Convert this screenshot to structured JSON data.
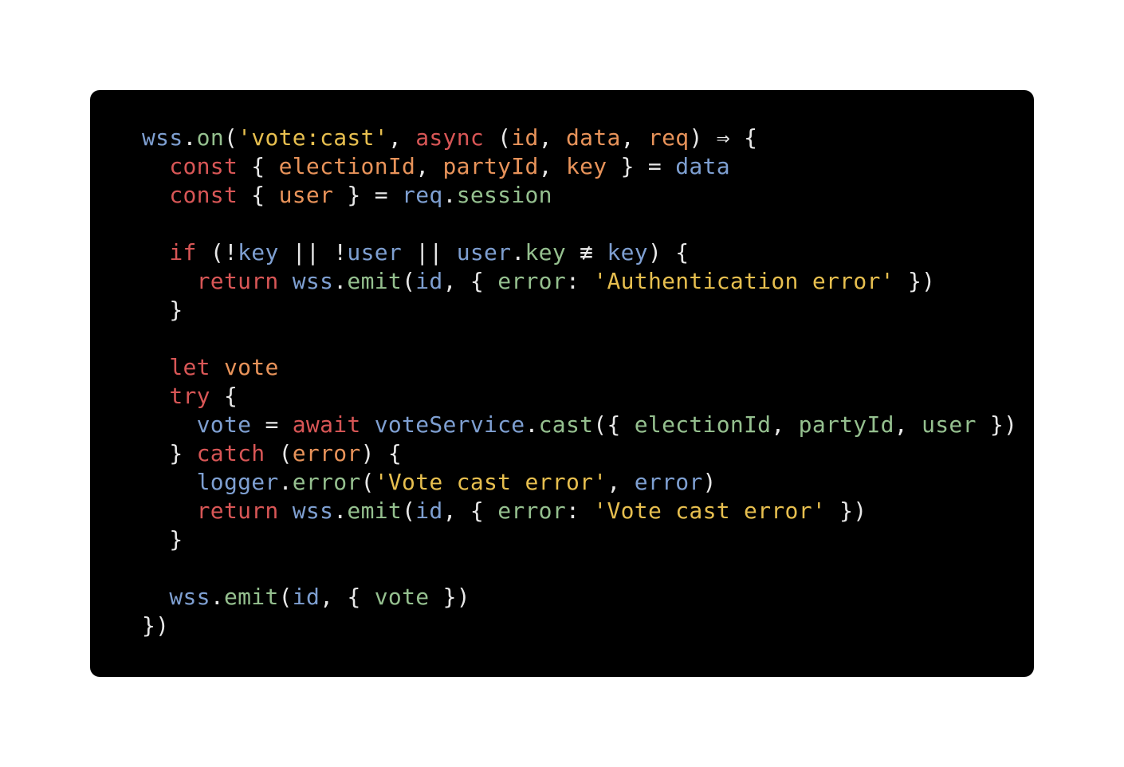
{
  "colors": {
    "page_background": "#ffffff",
    "editor_background": "#000000",
    "plain": "#e8e8e8",
    "identifier": "#7e9fd1",
    "property": "#95c08f",
    "string": "#e7bf4f",
    "keyword": "#d85656",
    "parameter": "#e8935a"
  },
  "code": {
    "language": "javascript",
    "lines": [
      [
        [
          "ident",
          "wss"
        ],
        [
          "plain",
          "."
        ],
        [
          "prop",
          "on"
        ],
        [
          "plain",
          "("
        ],
        [
          "string",
          "'vote:cast'"
        ],
        [
          "plain",
          ", "
        ],
        [
          "keyword",
          "async"
        ],
        [
          "plain",
          " ("
        ],
        [
          "param",
          "id"
        ],
        [
          "plain",
          ", "
        ],
        [
          "param",
          "data"
        ],
        [
          "plain",
          ", "
        ],
        [
          "param",
          "req"
        ],
        [
          "plain",
          ") ⇒ {"
        ]
      ],
      [
        [
          "plain",
          "  "
        ],
        [
          "keyword",
          "const"
        ],
        [
          "plain",
          " { "
        ],
        [
          "param",
          "electionId"
        ],
        [
          "plain",
          ", "
        ],
        [
          "param",
          "partyId"
        ],
        [
          "plain",
          ", "
        ],
        [
          "param",
          "key"
        ],
        [
          "plain",
          " } = "
        ],
        [
          "ident",
          "data"
        ]
      ],
      [
        [
          "plain",
          "  "
        ],
        [
          "keyword",
          "const"
        ],
        [
          "plain",
          " { "
        ],
        [
          "param",
          "user"
        ],
        [
          "plain",
          " } = "
        ],
        [
          "ident",
          "req"
        ],
        [
          "plain",
          "."
        ],
        [
          "prop",
          "session"
        ]
      ],
      [],
      [
        [
          "plain",
          "  "
        ],
        [
          "keyword",
          "if"
        ],
        [
          "plain",
          " (!"
        ],
        [
          "ident",
          "key"
        ],
        [
          "plain",
          " || !"
        ],
        [
          "ident",
          "user"
        ],
        [
          "plain",
          " || "
        ],
        [
          "ident",
          "user"
        ],
        [
          "plain",
          "."
        ],
        [
          "prop",
          "key"
        ],
        [
          "plain",
          " ≢ "
        ],
        [
          "ident",
          "key"
        ],
        [
          "plain",
          ") {"
        ]
      ],
      [
        [
          "plain",
          "    "
        ],
        [
          "keyword",
          "return"
        ],
        [
          "plain",
          " "
        ],
        [
          "ident",
          "wss"
        ],
        [
          "plain",
          "."
        ],
        [
          "prop",
          "emit"
        ],
        [
          "plain",
          "("
        ],
        [
          "ident",
          "id"
        ],
        [
          "plain",
          ", { "
        ],
        [
          "prop",
          "error"
        ],
        [
          "plain",
          ": "
        ],
        [
          "string",
          "'Authentication error'"
        ],
        [
          "plain",
          " })"
        ]
      ],
      [
        [
          "plain",
          "  }"
        ]
      ],
      [],
      [
        [
          "plain",
          "  "
        ],
        [
          "keyword",
          "let"
        ],
        [
          "plain",
          " "
        ],
        [
          "param",
          "vote"
        ]
      ],
      [
        [
          "plain",
          "  "
        ],
        [
          "keyword",
          "try"
        ],
        [
          "plain",
          " {"
        ]
      ],
      [
        [
          "plain",
          "    "
        ],
        [
          "ident",
          "vote"
        ],
        [
          "plain",
          " = "
        ],
        [
          "keyword",
          "await"
        ],
        [
          "plain",
          " "
        ],
        [
          "ident",
          "voteService"
        ],
        [
          "plain",
          "."
        ],
        [
          "prop",
          "cast"
        ],
        [
          "plain",
          "({ "
        ],
        [
          "prop",
          "electionId"
        ],
        [
          "plain",
          ", "
        ],
        [
          "prop",
          "partyId"
        ],
        [
          "plain",
          ", "
        ],
        [
          "prop",
          "user"
        ],
        [
          "plain",
          " })"
        ]
      ],
      [
        [
          "plain",
          "  } "
        ],
        [
          "keyword",
          "catch"
        ],
        [
          "plain",
          " ("
        ],
        [
          "param",
          "error"
        ],
        [
          "plain",
          ") {"
        ]
      ],
      [
        [
          "plain",
          "    "
        ],
        [
          "ident",
          "logger"
        ],
        [
          "plain",
          "."
        ],
        [
          "prop",
          "error"
        ],
        [
          "plain",
          "("
        ],
        [
          "string",
          "'Vote cast error'"
        ],
        [
          "plain",
          ", "
        ],
        [
          "ident",
          "error"
        ],
        [
          "plain",
          ")"
        ]
      ],
      [
        [
          "plain",
          "    "
        ],
        [
          "keyword",
          "return"
        ],
        [
          "plain",
          " "
        ],
        [
          "ident",
          "wss"
        ],
        [
          "plain",
          "."
        ],
        [
          "prop",
          "emit"
        ],
        [
          "plain",
          "("
        ],
        [
          "ident",
          "id"
        ],
        [
          "plain",
          ", { "
        ],
        [
          "prop",
          "error"
        ],
        [
          "plain",
          ": "
        ],
        [
          "string",
          "'Vote cast error'"
        ],
        [
          "plain",
          " })"
        ]
      ],
      [
        [
          "plain",
          "  }"
        ]
      ],
      [],
      [
        [
          "plain",
          "  "
        ],
        [
          "ident",
          "wss"
        ],
        [
          "plain",
          "."
        ],
        [
          "prop",
          "emit"
        ],
        [
          "plain",
          "("
        ],
        [
          "ident",
          "id"
        ],
        [
          "plain",
          ", { "
        ],
        [
          "prop",
          "vote"
        ],
        [
          "plain",
          " })"
        ]
      ],
      [
        [
          "plain",
          "})"
        ]
      ]
    ]
  }
}
